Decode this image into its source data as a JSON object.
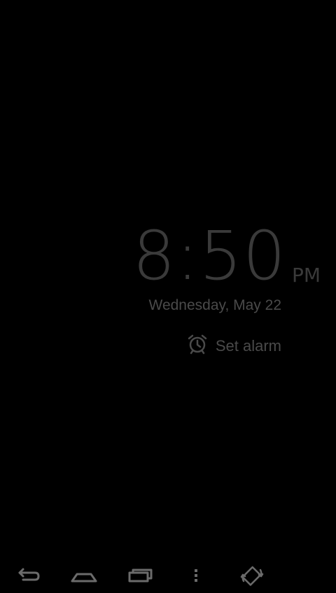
{
  "clock": {
    "time": "8:50",
    "ampm": "PM",
    "date": "Wednesday, May 22"
  },
  "alarm": {
    "label": "Set alarm",
    "icon": "alarm-clock-icon"
  },
  "navbar": {
    "buttons": [
      {
        "name": "back-button",
        "icon": "back-arrow-icon"
      },
      {
        "name": "home-button",
        "icon": "home-icon"
      },
      {
        "name": "recent-apps-button",
        "icon": "recent-apps-icon"
      },
      {
        "name": "menu-button",
        "icon": "overflow-menu-icon"
      },
      {
        "name": "rotate-button",
        "icon": "screen-rotation-icon"
      }
    ]
  },
  "colors": {
    "background": "#000000",
    "clock_text": "#3a3a3a",
    "secondary_text": "#4a4a4a",
    "nav_icon": "#6b6b6b"
  }
}
